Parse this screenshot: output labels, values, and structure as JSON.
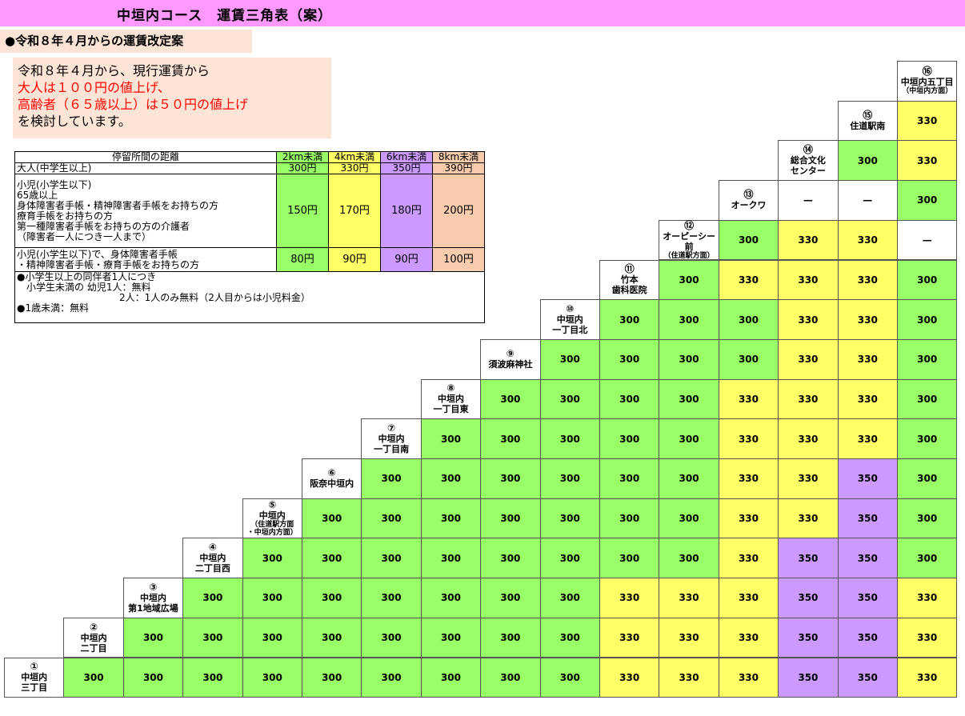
{
  "title": "中垣内コース　運賃三角表（案）",
  "subtitle": "●令和８年４月からの運賃改定案",
  "note": {
    "line1": "令和８年４月から、現行運賃から",
    "line2": "大人は１００円の値上げ、",
    "line3": "高齢者（６５歳以上）は５０円の値上げ",
    "line4": "を検討しています。"
  },
  "fare_table": {
    "header": [
      "停留所間の距離",
      "2km未満",
      "4km未満",
      "6km未満",
      "8km未満"
    ],
    "adult": {
      "label": "大人(中学生以上)",
      "values": [
        "300円",
        "330円",
        "350円",
        "390円"
      ]
    },
    "child": {
      "lines": [
        "小児(小学生以下)",
        "65歳以上",
        "身体障害者手帳・精神障害者手帳をお持ちの方",
        "療育手帳をお持ちの方",
        "第一種障害者手帳をお持ちの方の介護者",
        "（障害者一人につき一人まで）"
      ],
      "values": [
        "150円",
        "170円",
        "180円",
        "200円"
      ]
    },
    "child_disabled": {
      "lines": [
        "小児(小学生以下)で、身体障害者手帳",
        "・精神障害者手帳・療育手帳をお持ちの方"
      ],
      "values": [
        "80円",
        "90円",
        "90円",
        "100円"
      ]
    },
    "notes": [
      "●小学生以上の同伴者1人につき",
      "　小学生未満の 幼児1人：無料",
      "2人：1人のみ無料（2人目からは小児料金）",
      "●1歳未満：無料"
    ]
  },
  "stops": [
    {
      "num": "①",
      "name": "中垣内\n三丁目",
      "sub": ""
    },
    {
      "num": "②",
      "name": "中垣内\n二丁目",
      "sub": ""
    },
    {
      "num": "③",
      "name": "中垣内\n第1地域広場",
      "sub": ""
    },
    {
      "num": "④",
      "name": "中垣内\n二丁目西",
      "sub": ""
    },
    {
      "num": "⑤",
      "name": "中垣内",
      "sub": "（住道駅方面\n・中垣内方面）"
    },
    {
      "num": "⑥",
      "name": "阪奈中垣内",
      "sub": ""
    },
    {
      "num": "⑦",
      "name": "中垣内\n一丁目南",
      "sub": ""
    },
    {
      "num": "⑧",
      "name": "中垣内\n一丁目東",
      "sub": ""
    },
    {
      "num": "⑨",
      "name": "須波麻神社",
      "sub": ""
    },
    {
      "num": "⑩",
      "name": "中垣内\n一丁目北",
      "sub": ""
    },
    {
      "num": "⑪",
      "name": "竹本\n歯科医院",
      "sub": ""
    },
    {
      "num": "⑫",
      "name": "オーピーシー前",
      "sub": "（住道駅方面）"
    },
    {
      "num": "⑬",
      "name": "オークワ",
      "sub": ""
    },
    {
      "num": "⑭",
      "name": "総合文化\nセンター",
      "sub": ""
    },
    {
      "num": "⑮",
      "name": "住道駅南",
      "sub": ""
    },
    {
      "num": "⑯",
      "name": "中垣内五丁目",
      "sub": "（中垣内方面）"
    }
  ],
  "matrix": [
    [
      "300",
      "300",
      "300",
      "300",
      "300",
      "300",
      "300",
      "300",
      "300",
      "330",
      "330",
      "330",
      "350",
      "350",
      "330"
    ],
    [
      "300",
      "300",
      "300",
      "300",
      "300",
      "300",
      "300",
      "300",
      "330",
      "330",
      "330",
      "350",
      "350",
      "330"
    ],
    [
      "300",
      "300",
      "300",
      "300",
      "300",
      "300",
      "300",
      "330",
      "330",
      "330",
      "350",
      "350",
      "330"
    ],
    [
      "300",
      "300",
      "300",
      "300",
      "300",
      "300",
      "300",
      "300",
      "330",
      "350",
      "350",
      "300"
    ],
    [
      "300",
      "300",
      "300",
      "300",
      "300",
      "300",
      "300",
      "330",
      "330",
      "350",
      "300"
    ],
    [
      "300",
      "300",
      "300",
      "300",
      "300",
      "300",
      "330",
      "330",
      "350",
      "300"
    ],
    [
      "300",
      "300",
      "300",
      "300",
      "300",
      "330",
      "330",
      "330",
      "300"
    ],
    [
      "300",
      "300",
      "300",
      "300",
      "330",
      "330",
      "330",
      "300"
    ],
    [
      "300",
      "300",
      "300",
      "300",
      "330",
      "330",
      "300"
    ],
    [
      "300",
      "300",
      "300",
      "330",
      "330",
      "300"
    ],
    [
      "300",
      "330",
      "330",
      "330",
      "300"
    ],
    [
      "300",
      "330",
      "330",
      "—"
    ],
    [
      "—",
      "—",
      "300"
    ],
    [
      "300",
      "330"
    ],
    [
      "330"
    ]
  ],
  "colors": {
    "300": "#99ff66",
    "330": "#ffff66",
    "350": "#cc99ff",
    "—": "#ffffff",
    "title_bg": "#ff99ff",
    "note_bg": "#fce4d6"
  }
}
